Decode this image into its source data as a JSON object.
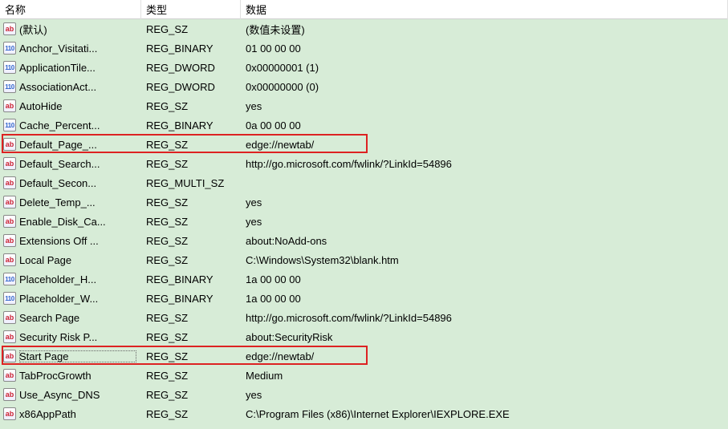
{
  "headers": {
    "name": "名称",
    "type": "类型",
    "data": "数据"
  },
  "rows": [
    {
      "icon": "sz",
      "name": "(默认)",
      "type": "REG_SZ",
      "data": "(数值未设置)",
      "highlight": false,
      "sel": false
    },
    {
      "icon": "bin",
      "name": "Anchor_Visitati...",
      "type": "REG_BINARY",
      "data": "01 00 00 00",
      "highlight": false,
      "sel": false
    },
    {
      "icon": "bin",
      "name": "ApplicationTile...",
      "type": "REG_DWORD",
      "data": "0x00000001 (1)",
      "highlight": false,
      "sel": false
    },
    {
      "icon": "bin",
      "name": "AssociationAct...",
      "type": "REG_DWORD",
      "data": "0x00000000 (0)",
      "highlight": false,
      "sel": false
    },
    {
      "icon": "sz",
      "name": "AutoHide",
      "type": "REG_SZ",
      "data": "yes",
      "highlight": false,
      "sel": false
    },
    {
      "icon": "bin",
      "name": "Cache_Percent...",
      "type": "REG_BINARY",
      "data": "0a 00 00 00",
      "highlight": false,
      "sel": false
    },
    {
      "icon": "sz",
      "name": "Default_Page_...",
      "type": "REG_SZ",
      "data": "edge://newtab/",
      "highlight": true,
      "sel": false
    },
    {
      "icon": "sz",
      "name": "Default_Search...",
      "type": "REG_SZ",
      "data": "http://go.microsoft.com/fwlink/?LinkId=54896",
      "highlight": false,
      "sel": false
    },
    {
      "icon": "sz",
      "name": "Default_Secon...",
      "type": "REG_MULTI_SZ",
      "data": "",
      "highlight": false,
      "sel": false
    },
    {
      "icon": "sz",
      "name": "Delete_Temp_...",
      "type": "REG_SZ",
      "data": "yes",
      "highlight": false,
      "sel": false
    },
    {
      "icon": "sz",
      "name": "Enable_Disk_Ca...",
      "type": "REG_SZ",
      "data": "yes",
      "highlight": false,
      "sel": false
    },
    {
      "icon": "sz",
      "name": "Extensions Off ...",
      "type": "REG_SZ",
      "data": "about:NoAdd-ons",
      "highlight": false,
      "sel": false
    },
    {
      "icon": "sz",
      "name": "Local Page",
      "type": "REG_SZ",
      "data": "C:\\Windows\\System32\\blank.htm",
      "highlight": false,
      "sel": false
    },
    {
      "icon": "bin",
      "name": "Placeholder_H...",
      "type": "REG_BINARY",
      "data": "1a 00 00 00",
      "highlight": false,
      "sel": false
    },
    {
      "icon": "bin",
      "name": "Placeholder_W...",
      "type": "REG_BINARY",
      "data": "1a 00 00 00",
      "highlight": false,
      "sel": false
    },
    {
      "icon": "sz",
      "name": "Search Page",
      "type": "REG_SZ",
      "data": "http://go.microsoft.com/fwlink/?LinkId=54896",
      "highlight": false,
      "sel": false
    },
    {
      "icon": "sz",
      "name": "Security Risk P...",
      "type": "REG_SZ",
      "data": "about:SecurityRisk",
      "highlight": false,
      "sel": false
    },
    {
      "icon": "sz",
      "name": "Start Page",
      "type": "REG_SZ",
      "data": "edge://newtab/",
      "highlight": true,
      "sel": true
    },
    {
      "icon": "sz",
      "name": "TabProcGrowth",
      "type": "REG_SZ",
      "data": "Medium",
      "highlight": false,
      "sel": false
    },
    {
      "icon": "sz",
      "name": "Use_Async_DNS",
      "type": "REG_SZ",
      "data": "yes",
      "highlight": false,
      "sel": false
    },
    {
      "icon": "sz",
      "name": "x86AppPath",
      "type": "REG_SZ",
      "data": "C:\\Program Files (x86)\\Internet Explorer\\IEXPLORE.EXE",
      "highlight": false,
      "sel": false
    }
  ]
}
